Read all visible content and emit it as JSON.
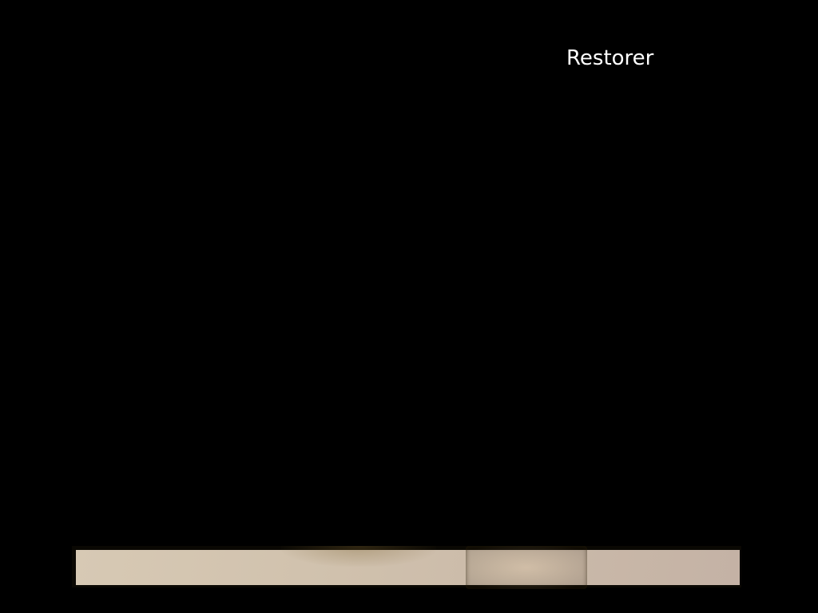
{
  "screen": {
    "title": "Restorer",
    "colors": {
      "background": "#000000",
      "title_text": "#ffffff",
      "bar_fill_start": "#d7c9b4",
      "bar_fill_end": "#c4b2a5"
    }
  }
}
